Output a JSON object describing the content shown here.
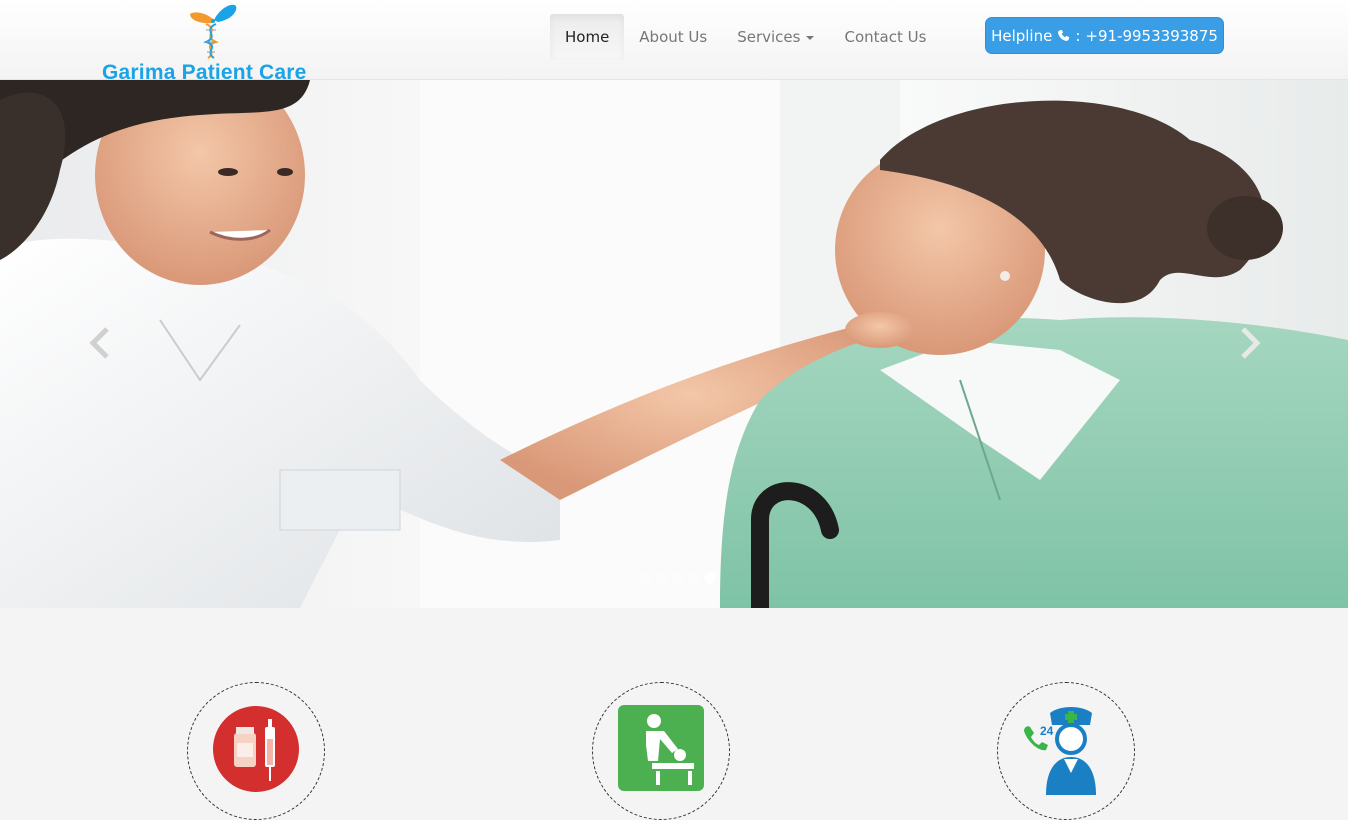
{
  "brand": {
    "name": "Garima Patient Care",
    "logo_icon": "caduceus-butterfly-logo"
  },
  "nav": {
    "items": [
      {
        "label": "Home",
        "active": true
      },
      {
        "label": "About Us",
        "active": false
      },
      {
        "label": "Services",
        "active": false,
        "dropdown": true
      },
      {
        "label": "Contact Us",
        "active": false
      }
    ]
  },
  "helpline": {
    "prefix": "Helpline",
    "icon": "phone-icon",
    "separator": ":",
    "number": "+91-9953393875"
  },
  "carousel": {
    "slide_image": "nurse-with-elderly-woman-photo",
    "prev_icon": "chevron-left-icon",
    "next_icon": "chevron-right-icon",
    "indicator_count": 4,
    "active_indicator": 4
  },
  "services": [
    {
      "icon": "medicine-syringe-icon"
    },
    {
      "icon": "baby-changing-icon"
    },
    {
      "icon": "24h-nurse-support-icon"
    }
  ],
  "colors": {
    "brand_blue": "#1aa3e6",
    "helpline_bg": "#3a9ee6",
    "service_red": "#d32f2f",
    "service_green": "#4caf50",
    "service_blue": "#1b7fc4"
  }
}
